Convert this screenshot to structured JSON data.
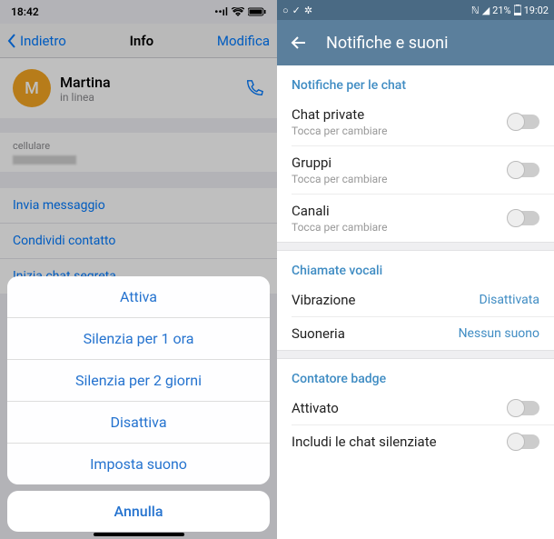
{
  "ios": {
    "status": {
      "time": "18:42"
    },
    "nav": {
      "back": "Indietro",
      "title": "Info",
      "edit": "Modifica"
    },
    "contact": {
      "initial": "M",
      "name": "Martina",
      "status": "in linea"
    },
    "phone_label": "cellulare",
    "links": [
      "Invia messaggio",
      "Condividi contatto",
      "Inizia chat segreta"
    ],
    "sheet": {
      "items": [
        "Attiva",
        "Silenzia per 1 ora",
        "Silenzia per 2 giorni",
        "Disattiva",
        "Imposta suono"
      ],
      "cancel": "Annulla"
    }
  },
  "android": {
    "status": {
      "battery": "21%",
      "time": "19:02"
    },
    "header_title": "Notifiche e suoni",
    "sections": {
      "chat": {
        "title": "Notifiche per le chat",
        "items": [
          {
            "title": "Chat private",
            "sub": "Tocca per cambiare"
          },
          {
            "title": "Gruppi",
            "sub": "Tocca per cambiare"
          },
          {
            "title": "Canali",
            "sub": "Tocca per cambiare"
          }
        ]
      },
      "calls": {
        "title": "Chiamate vocali",
        "items": [
          {
            "title": "Vibrazione",
            "value": "Disattivata"
          },
          {
            "title": "Suoneria",
            "value": "Nessun suono"
          }
        ]
      },
      "badge": {
        "title": "Contatore badge",
        "items": [
          {
            "title": "Attivato"
          },
          {
            "title": "Includi le chat silenziate"
          }
        ]
      }
    }
  }
}
